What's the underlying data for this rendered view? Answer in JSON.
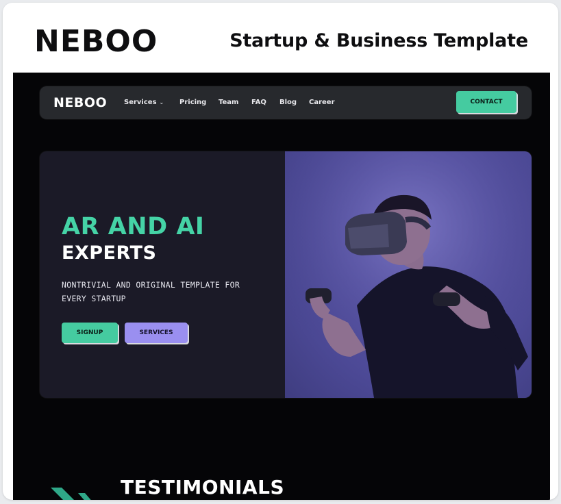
{
  "header": {
    "brand": "NEBOO",
    "tagline": "Startup & Business Template"
  },
  "preview": {
    "nav": {
      "logo": "NEBOO",
      "items": [
        "Services",
        "Pricing",
        "Team",
        "FAQ",
        "Blog",
        "Career"
      ],
      "contact_label": "CONTACT"
    },
    "hero": {
      "title_line1": "AR AND AI",
      "title_line2": "EXPERTS",
      "description": "NONTRIVIAL AND ORIGINAL TEMPLATE FOR EVERY STARTUP",
      "signup_label": "SIGNUP",
      "services_label": "SERVICES",
      "image_icon": "vr-headset-person-photo"
    },
    "testimonials_title": "TESTIMONIALS"
  },
  "colors": {
    "accent_green": "#45cba0",
    "accent_purple": "#9a8ff0",
    "dark_bg": "#050507",
    "hero_bg": "#1b1a27"
  }
}
